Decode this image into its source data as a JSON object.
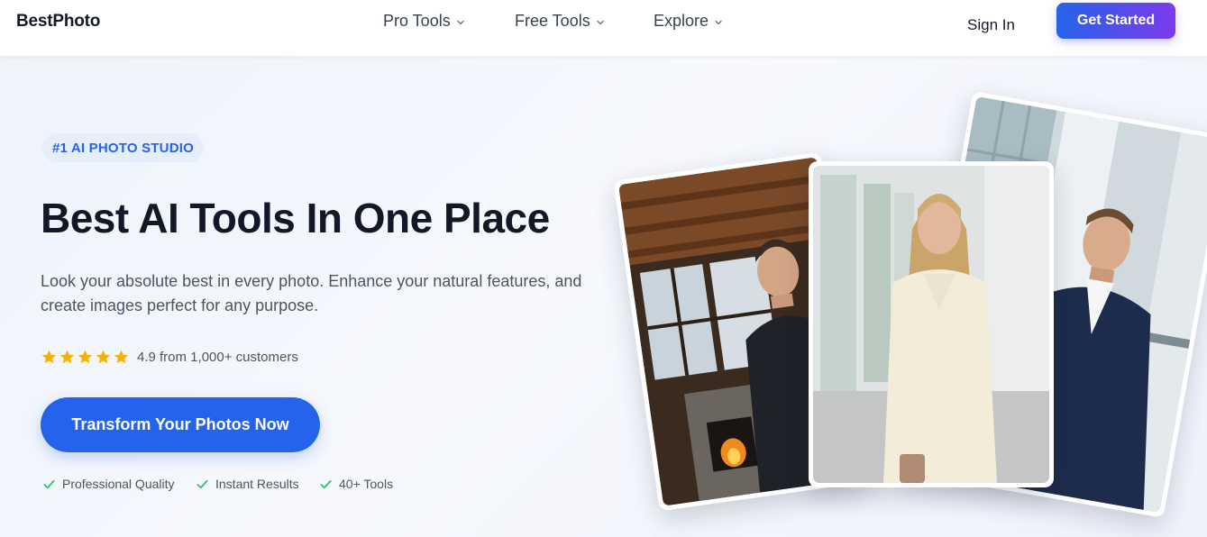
{
  "header": {
    "logo": "BestPhoto",
    "nav": [
      {
        "label": "Pro Tools"
      },
      {
        "label": "Free Tools"
      },
      {
        "label": "Explore"
      }
    ],
    "sign_in": "Sign In",
    "get_started": "Get Started"
  },
  "hero": {
    "badge": "#1 AI PHOTO STUDIO",
    "headline": "Best AI Tools In One Place",
    "subheadline": "Look your absolute best in every photo. Enhance your natural features, and create images perfect for any purpose.",
    "rating": {
      "stars": 5,
      "text": "4.9 from 1,000+ customers"
    },
    "cta": "Transform Your Photos Now",
    "features": [
      "Professional Quality",
      "Instant Results",
      "40+ Tools"
    ]
  },
  "photos": [
    {
      "icon": "man-by-fireplace-photo"
    },
    {
      "icon": "woman-in-cream-suit-photo"
    },
    {
      "icon": "man-in-navy-suit-photo"
    }
  ],
  "colors": {
    "accent": "#2563eb",
    "gradient_end": "#7c3aed",
    "star": "#f5b301",
    "check": "#22c55e",
    "heading": "#111827",
    "body_text": "#4b5563"
  }
}
